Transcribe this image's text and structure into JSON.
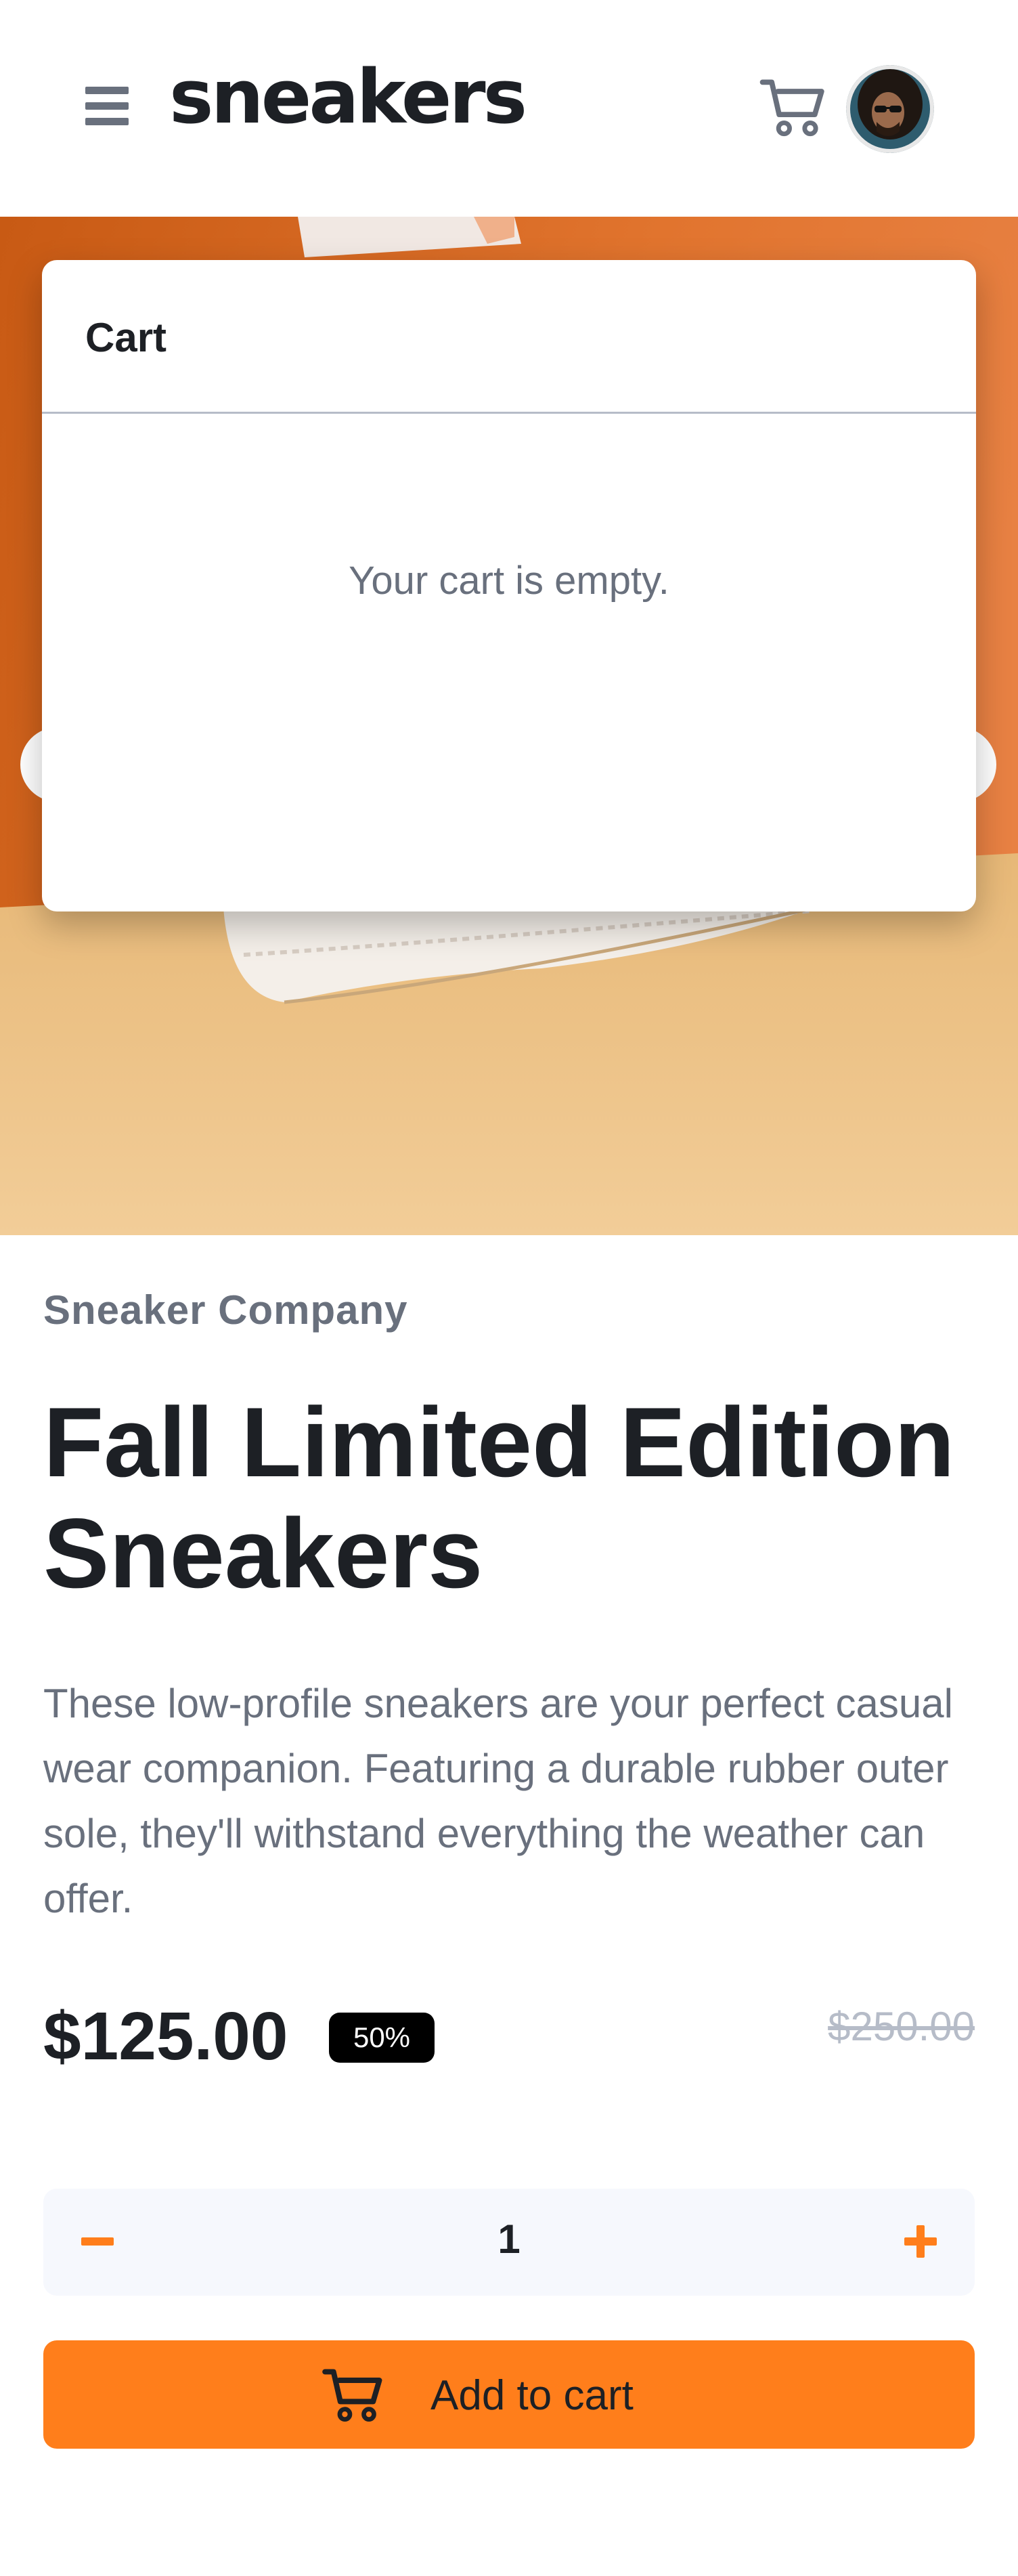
{
  "header": {
    "logo": "sneakers",
    "menu_icon": "hamburger-menu-icon",
    "cart_icon": "cart-icon",
    "avatar_icon": "user-avatar"
  },
  "hero": {
    "prev_icon": "chevron-left-icon",
    "next_icon": "chevron-right-icon"
  },
  "cart": {
    "title": "Cart",
    "empty_message": "Your cart is empty."
  },
  "product": {
    "company": "Sneaker Company",
    "title": "Fall Limited Edition Sneakers",
    "description": "These low-profile sneakers are your perfect casual wear companion. Featuring a durable rubber outer sole, they'll withstand everything the weather can offer.",
    "price": "$125.00",
    "discount": "50%",
    "original_price": "$250.00"
  },
  "quantity": {
    "value": "1",
    "minus_icon": "minus-icon",
    "plus_icon": "plus-icon"
  },
  "add_to_cart": {
    "label": "Add to cart",
    "icon": "cart-icon"
  },
  "colors": {
    "accent": "#ff7e1b",
    "text_dark": "#1d2025",
    "text_muted": "#69707d",
    "text_light": "#b6bcc8",
    "qty_bg": "#f6f8fd"
  }
}
